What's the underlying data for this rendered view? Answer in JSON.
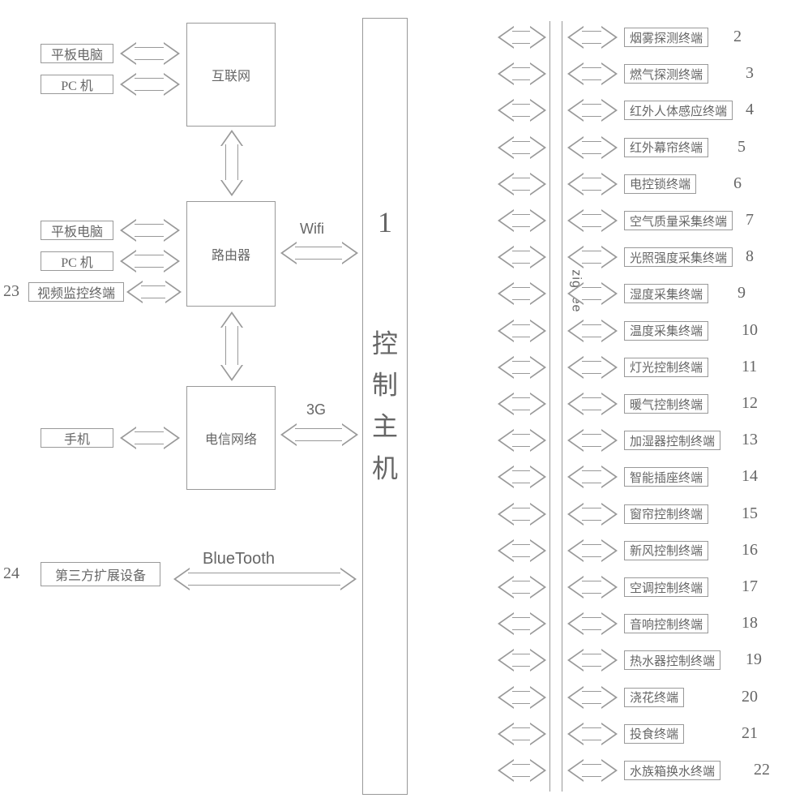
{
  "central": {
    "num": "1",
    "label": "控\n制\n主\n机"
  },
  "zigbee_label": "zigbee",
  "left": {
    "group1": {
      "net_box": "互联网",
      "devices": [
        "平板电脑",
        "PC 机"
      ]
    },
    "group2": {
      "net_box": "路由器",
      "net_label": "Wifi",
      "devices": [
        "平板电脑",
        "PC 机",
        "视频监控终端"
      ],
      "num23": "23"
    },
    "group3": {
      "net_box": "电信网络",
      "net_label": "3G",
      "devices": [
        "手机"
      ]
    },
    "group4": {
      "device": "第三方扩展设备",
      "label": "BlueTooth",
      "num24": "24"
    }
  },
  "right": [
    {
      "n": "2",
      "label": "烟雾探测终端"
    },
    {
      "n": "3",
      "label": "燃气探测终端"
    },
    {
      "n": "4",
      "label": "红外人体感应终端"
    },
    {
      "n": "5",
      "label": "红外幕帘终端"
    },
    {
      "n": "6",
      "label": "电控锁终端"
    },
    {
      "n": "7",
      "label": "空气质量采集终端"
    },
    {
      "n": "8",
      "label": "光照强度采集终端"
    },
    {
      "n": "9",
      "label": "湿度采集终端"
    },
    {
      "n": "10",
      "label": "温度采集终端"
    },
    {
      "n": "11",
      "label": "灯光控制终端"
    },
    {
      "n": "12",
      "label": "暖气控制终端"
    },
    {
      "n": "13",
      "label": "加湿器控制终端"
    },
    {
      "n": "14",
      "label": "智能插座终端"
    },
    {
      "n": "15",
      "label": "窗帘控制终端"
    },
    {
      "n": "16",
      "label": "新风控制终端"
    },
    {
      "n": "17",
      "label": "空调控制终端"
    },
    {
      "n": "18",
      "label": "音响控制终端"
    },
    {
      "n": "19",
      "label": "热水器控制终端"
    },
    {
      "n": "20",
      "label": "浇花终端"
    },
    {
      "n": "21",
      "label": "投食终端"
    },
    {
      "n": "22",
      "label": "水族箱换水终端"
    }
  ],
  "right_num_x": [
    305,
    320,
    320,
    310,
    305,
    320,
    320,
    310,
    315,
    315,
    315,
    315,
    315,
    315,
    315,
    315,
    315,
    320,
    315,
    315,
    330
  ]
}
